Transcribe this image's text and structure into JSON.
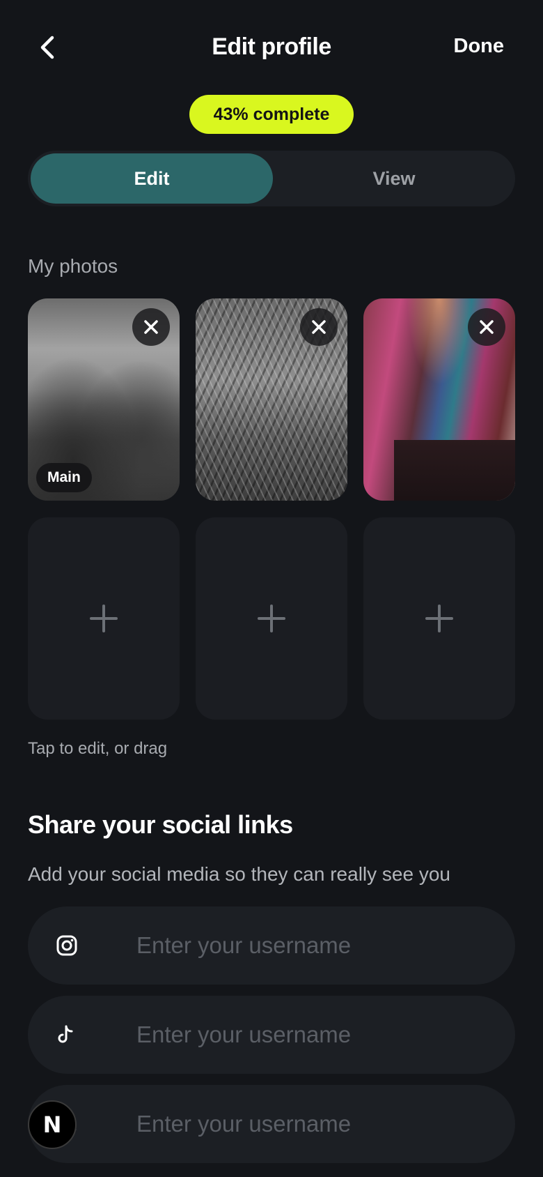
{
  "header": {
    "title": "Edit profile",
    "done_label": "Done",
    "back_icon": "chevron-left-icon"
  },
  "progress": {
    "label": "43% complete",
    "percent": 43,
    "color": "#d9f71f"
  },
  "mode_tabs": [
    {
      "label": "Edit",
      "active": true
    },
    {
      "label": "View",
      "active": false
    }
  ],
  "photos": {
    "section_label": "My photos",
    "main_badge": "Main",
    "hint": "Tap to edit, or drag"
  },
  "social": {
    "title": "Share your social links",
    "subtitle": "Add your social media so they can really see you",
    "fields": [
      {
        "icon": "instagram-icon",
        "placeholder": "Enter your username"
      },
      {
        "icon": "tiktok-icon",
        "placeholder": "Enter your username"
      },
      {
        "icon": "snapchat-icon",
        "placeholder": "Enter your username"
      }
    ]
  },
  "overlay": {
    "avatar_letter": "N"
  },
  "colors": {
    "background": "#131519",
    "accent_tab": "#2c6769",
    "progress_pill": "#d9f71f"
  }
}
